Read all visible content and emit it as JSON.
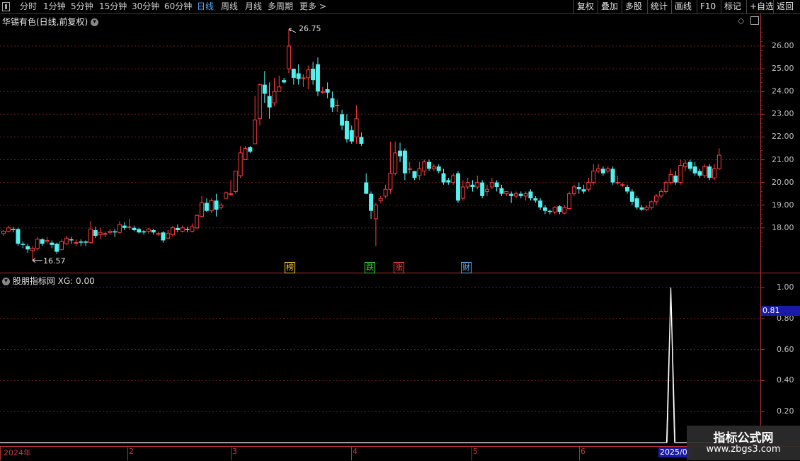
{
  "toolbar": {
    "left": [
      "分时",
      "1分钟",
      "5分钟",
      "15分钟",
      "30分钟",
      "60分钟",
      "日线",
      "周线",
      "月线",
      "多周期",
      "更多 >"
    ],
    "active_index": 6,
    "right": [
      "复权",
      "叠加",
      "多股",
      "统计",
      "画线",
      "F10",
      "标记",
      "+自选",
      "返回"
    ]
  },
  "stock_title": "华锡有色(日线,前复权)",
  "indicator_title": "股朋指标网 XG: 0.00",
  "price_axis": {
    "ticks": [
      "26.00",
      "25.00",
      "24.00",
      "23.00",
      "22.00",
      "21.00",
      "20.00",
      "19.00",
      "18.00"
    ]
  },
  "indicator_axis": {
    "ticks": [
      "1.00",
      "0.80",
      "0.60",
      "0.40",
      "0.20"
    ],
    "cursor_value": "0.81"
  },
  "markers": {
    "high": "26.75",
    "low": "16.57"
  },
  "events": [
    {
      "label": "榜",
      "color": "#ffcc33"
    },
    {
      "label": "跌",
      "color": "#33dd33"
    },
    {
      "label": "涨",
      "color": "#ff4444"
    },
    {
      "label": "财",
      "color": "#66bbff"
    }
  ],
  "dates": {
    "year": "2024年",
    "months": [
      "2",
      "3",
      "4",
      "5",
      "6"
    ],
    "cursor_date": "2025/0"
  },
  "watermark": {
    "line1": "指标公式网",
    "line2": "www.zbgs3.com"
  },
  "colors": {
    "up": "#ff3c3c",
    "down": "#54f0f0",
    "grid": "#6a1e1e",
    "axis": "#b03030",
    "signal": "#ffffff"
  },
  "chart_data": {
    "type": "candlestick",
    "candles": [
      [
        17.75,
        17.85,
        17.65,
        17.9
      ],
      [
        17.85,
        18.0,
        17.8,
        18.1
      ],
      [
        17.95,
        17.9,
        17.8,
        18.05
      ],
      [
        17.95,
        17.3,
        17.2,
        18.0
      ],
      [
        17.3,
        17.25,
        17.1,
        17.4
      ],
      [
        17.2,
        17.05,
        16.9,
        17.3
      ],
      [
        17.0,
        17.1,
        16.57,
        17.2
      ],
      [
        17.1,
        17.5,
        17.0,
        17.6
      ],
      [
        17.5,
        17.3,
        17.2,
        17.55
      ],
      [
        17.4,
        17.45,
        17.3,
        17.6
      ],
      [
        17.35,
        17.25,
        17.1,
        17.45
      ],
      [
        17.3,
        16.95,
        16.85,
        17.35
      ],
      [
        17.05,
        17.4,
        17.0,
        17.5
      ],
      [
        17.3,
        17.55,
        17.25,
        17.65
      ],
      [
        17.5,
        17.45,
        17.3,
        17.6
      ],
      [
        17.35,
        17.35,
        17.2,
        17.5
      ],
      [
        17.4,
        17.35,
        17.2,
        17.5
      ],
      [
        17.4,
        17.35,
        17.2,
        17.45
      ],
      [
        17.35,
        17.95,
        17.3,
        18.3
      ],
      [
        17.9,
        17.65,
        17.55,
        18.05
      ],
      [
        17.7,
        17.8,
        17.5,
        18.0
      ],
      [
        17.75,
        17.75,
        17.6,
        17.85
      ],
      [
        17.8,
        17.85,
        17.7,
        17.95
      ],
      [
        17.85,
        17.8,
        17.6,
        17.95
      ],
      [
        17.8,
        18.15,
        17.75,
        18.3
      ],
      [
        18.1,
        18.0,
        17.9,
        18.25
      ],
      [
        18.05,
        18.05,
        17.9,
        18.4
      ],
      [
        18.0,
        17.9,
        17.85,
        18.1
      ],
      [
        17.95,
        17.8,
        17.75,
        18.0
      ],
      [
        17.85,
        17.8,
        17.7,
        17.9
      ],
      [
        17.85,
        17.95,
        17.75,
        18.0
      ],
      [
        17.9,
        17.8,
        17.7,
        17.95
      ],
      [
        17.75,
        17.75,
        17.65,
        17.85
      ],
      [
        17.8,
        17.45,
        17.35,
        17.85
      ],
      [
        17.55,
        17.75,
        17.5,
        17.9
      ],
      [
        17.7,
        18.0,
        17.6,
        18.1
      ],
      [
        18.0,
        17.9,
        17.8,
        18.15
      ],
      [
        17.85,
        18.0,
        17.8,
        18.1
      ],
      [
        17.95,
        17.9,
        17.8,
        18.05
      ],
      [
        17.85,
        18.05,
        17.8,
        18.2
      ],
      [
        18.0,
        18.55,
        17.95,
        18.6
      ],
      [
        18.5,
        19.1,
        18.45,
        19.4
      ],
      [
        19.1,
        18.75,
        18.7,
        19.3
      ],
      [
        18.75,
        19.2,
        18.65,
        19.3
      ],
      [
        19.2,
        18.8,
        18.5,
        19.5
      ],
      [
        18.9,
        19.0,
        18.8,
        19.1
      ],
      [
        19.3,
        19.55,
        19.3,
        19.6
      ],
      [
        19.5,
        19.5,
        19.4,
        20.1
      ],
      [
        19.6,
        20.5,
        19.5,
        20.5
      ],
      [
        20.3,
        21.3,
        20.2,
        21.6
      ],
      [
        21.0,
        21.5,
        21.0,
        21.6
      ],
      [
        21.55,
        21.35,
        21.3,
        21.6
      ],
      [
        21.7,
        22.75,
        21.7,
        23.8
      ],
      [
        22.8,
        24.3,
        22.5,
        24.35
      ],
      [
        24.3,
        23.9,
        23.5,
        24.9
      ],
      [
        23.8,
        23.3,
        22.8,
        24.4
      ],
      [
        23.5,
        24.0,
        23.35,
        24.6
      ],
      [
        24.0,
        24.2,
        24.0,
        24.7
      ],
      [
        24.5,
        24.4,
        24.35,
        24.6
      ],
      [
        25.0,
        26.0,
        24.8,
        26.75
      ],
      [
        25.0,
        24.6,
        24.3,
        25.0
      ],
      [
        24.8,
        24.55,
        24.3,
        25.2
      ],
      [
        24.6,
        24.6,
        24.2,
        24.75
      ],
      [
        24.6,
        24.95,
        24.1,
        25.15
      ],
      [
        25.0,
        24.5,
        24.3,
        25.3
      ],
      [
        25.2,
        24.0,
        23.8,
        25.5
      ],
      [
        24.0,
        24.0,
        23.9,
        24.2
      ],
      [
        24.1,
        23.95,
        23.7,
        24.4
      ],
      [
        23.7,
        23.3,
        23.1,
        24.0
      ],
      [
        23.4,
        23.4,
        23.1,
        23.65
      ],
      [
        23.0,
        22.5,
        22.3,
        23.2
      ],
      [
        22.7,
        21.9,
        21.75,
        23.0
      ],
      [
        22.3,
        21.8,
        21.7,
        22.5
      ],
      [
        22.0,
        22.8,
        21.7,
        23.4
      ],
      [
        22.0,
        21.7,
        21.6,
        22.2
      ],
      [
        20.0,
        19.5,
        19.5,
        20.4
      ],
      [
        19.5,
        18.75,
        18.4,
        19.6
      ],
      [
        18.4,
        19.0,
        17.2,
        19.1
      ],
      [
        19.2,
        19.3,
        19.1,
        19.4
      ],
      [
        19.4,
        19.7,
        19.3,
        19.9
      ],
      [
        19.7,
        20.4,
        19.5,
        21.8
      ],
      [
        20.4,
        21.3,
        20.3,
        21.8
      ],
      [
        21.4,
        21.15,
        20.9,
        21.75
      ],
      [
        21.4,
        20.4,
        20.1,
        21.5
      ],
      [
        20.6,
        20.6,
        20.4,
        20.9
      ],
      [
        20.5,
        20.2,
        20.1,
        20.5
      ],
      [
        20.3,
        20.6,
        20.1,
        20.9
      ],
      [
        20.5,
        20.9,
        20.3,
        21.0
      ],
      [
        20.9,
        20.6,
        20.5,
        21.0
      ],
      [
        20.6,
        20.7,
        20.5,
        20.8
      ],
      [
        20.7,
        20.5,
        20.4,
        20.8
      ],
      [
        20.4,
        20.0,
        19.9,
        20.6
      ],
      [
        20.1,
        20.0,
        19.9,
        20.2
      ],
      [
        20.0,
        20.3,
        19.9,
        20.4
      ],
      [
        20.4,
        19.2,
        19.1,
        20.5
      ],
      [
        19.3,
        19.8,
        19.2,
        20.1
      ],
      [
        19.8,
        20.0,
        19.7,
        20.2
      ],
      [
        19.9,
        19.8,
        19.6,
        20.1
      ],
      [
        19.8,
        20.0,
        19.7,
        20.3
      ],
      [
        20.0,
        19.4,
        19.3,
        20.1
      ],
      [
        19.6,
        19.7,
        19.4,
        19.9
      ],
      [
        19.8,
        20.0,
        19.7,
        20.2
      ],
      [
        20.0,
        19.8,
        19.6,
        20.1
      ],
      [
        19.75,
        19.5,
        19.4,
        19.9
      ],
      [
        19.5,
        19.6,
        19.4,
        19.6
      ],
      [
        19.5,
        19.4,
        19.1,
        19.6
      ],
      [
        19.4,
        19.5,
        19.3,
        19.6
      ],
      [
        19.5,
        19.4,
        19.3,
        19.6
      ],
      [
        19.4,
        19.5,
        19.2,
        19.6
      ],
      [
        19.6,
        19.3,
        19.2,
        19.7
      ],
      [
        19.3,
        19.2,
        19.1,
        19.4
      ],
      [
        19.2,
        18.9,
        18.8,
        19.3
      ],
      [
        18.9,
        18.75,
        18.6,
        19.0
      ],
      [
        18.75,
        18.7,
        18.6,
        18.8
      ],
      [
        18.7,
        18.9,
        18.6,
        18.95
      ],
      [
        18.95,
        18.7,
        18.6,
        19.0
      ],
      [
        18.65,
        18.9,
        18.6,
        19.0
      ],
      [
        18.85,
        19.5,
        18.8,
        19.6
      ],
      [
        19.5,
        19.8,
        19.4,
        19.9
      ],
      [
        19.8,
        19.7,
        19.5,
        20.0
      ],
      [
        19.7,
        19.6,
        19.5,
        19.9
      ],
      [
        19.7,
        20.0,
        19.6,
        20.2
      ],
      [
        20.0,
        20.5,
        19.9,
        20.8
      ],
      [
        20.5,
        20.6,
        20.4,
        20.8
      ],
      [
        20.6,
        20.4,
        20.3,
        20.7
      ],
      [
        20.5,
        20.6,
        20.4,
        20.7
      ],
      [
        20.6,
        20.0,
        19.9,
        20.7
      ],
      [
        20.0,
        20.0,
        19.9,
        20.3
      ],
      [
        19.9,
        19.9,
        19.8,
        20.0
      ],
      [
        19.8,
        19.6,
        19.5,
        19.9
      ],
      [
        19.6,
        19.15,
        19.0,
        19.7
      ],
      [
        19.3,
        18.9,
        18.8,
        19.4
      ],
      [
        18.9,
        18.8,
        18.75,
        19.0
      ],
      [
        18.8,
        18.9,
        18.75,
        19.0
      ],
      [
        18.9,
        19.15,
        18.8,
        19.2
      ],
      [
        19.15,
        19.4,
        19.0,
        19.5
      ],
      [
        19.4,
        19.6,
        19.3,
        19.7
      ],
      [
        19.6,
        20.0,
        19.5,
        20.1
      ],
      [
        20.0,
        20.35,
        19.9,
        20.6
      ],
      [
        20.3,
        20.0,
        19.9,
        20.5
      ],
      [
        20.0,
        20.75,
        19.9,
        21.0
      ],
      [
        20.7,
        20.85,
        20.5,
        21.0
      ],
      [
        20.9,
        20.6,
        20.5,
        21.0
      ],
      [
        20.7,
        20.4,
        20.3,
        20.9
      ],
      [
        20.5,
        20.3,
        20.2,
        20.6
      ],
      [
        20.3,
        20.7,
        20.2,
        20.8
      ],
      [
        20.7,
        20.2,
        20.1,
        20.8
      ],
      [
        20.2,
        20.6,
        20.1,
        20.8
      ],
      [
        20.6,
        21.2,
        20.55,
        21.5
      ]
    ],
    "indicator": {
      "name": "XG",
      "value_label": "0.00",
      "spike_index": 138,
      "spike_value": 1.0
    },
    "ylim_price": [
      17.0,
      27.0
    ],
    "ylim_indicator": [
      0,
      1.05
    ]
  }
}
